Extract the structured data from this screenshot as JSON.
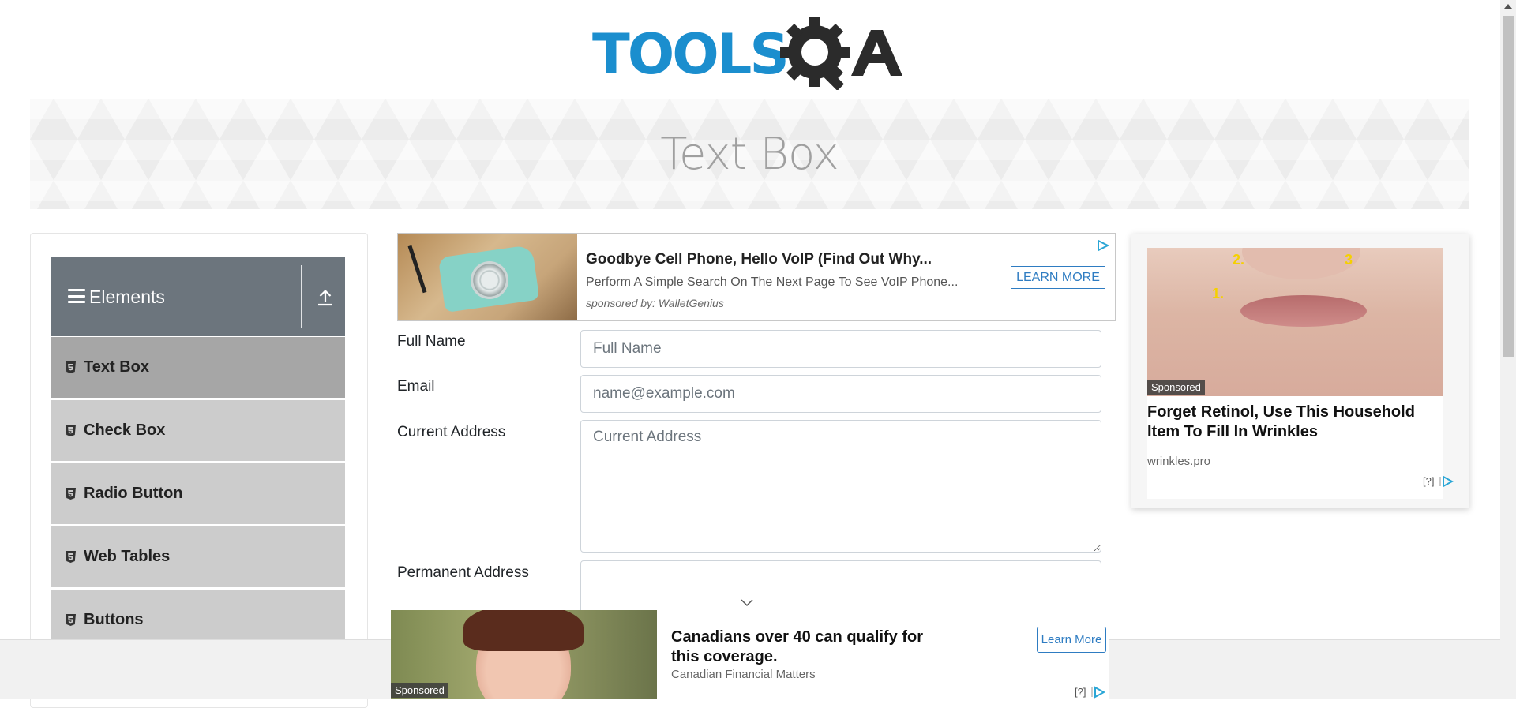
{
  "header": {
    "logo_text": "TOOLSQA",
    "page_title": "Text Box"
  },
  "sidebar": {
    "group_title": "Elements",
    "items": [
      {
        "label": "Text Box",
        "active": true
      },
      {
        "label": "Check Box",
        "active": false
      },
      {
        "label": "Radio Button",
        "active": false
      },
      {
        "label": "Web Tables",
        "active": false
      },
      {
        "label": "Buttons",
        "active": false
      }
    ]
  },
  "top_ad": {
    "headline": "Goodbye Cell Phone, Hello VoIP (Find Out Why...",
    "description": "Perform A Simple Search On The Next Page To See VoIP Phone...",
    "sponsor": "sponsored by: WalletGenius",
    "cta": "LEARN MORE"
  },
  "form": {
    "full_name": {
      "label": "Full Name",
      "placeholder": "Full Name",
      "value": ""
    },
    "email": {
      "label": "Email",
      "placeholder": "name@example.com",
      "value": ""
    },
    "current_address": {
      "label": "Current Address",
      "placeholder": "Current Address",
      "value": ""
    },
    "permanent_address": {
      "label": "Permanent Address",
      "placeholder": "",
      "value": ""
    }
  },
  "right_ad": {
    "badge": "Sponsored",
    "markers": [
      "1.",
      "2.",
      "3"
    ],
    "headline": "Forget Retinol, Use This Household Item To Fill In Wrinkles",
    "domain": "wrinkles.pro",
    "help": "[?]"
  },
  "bottom_ad": {
    "badge": "Sponsored",
    "headline": "Canadians over 40 can qualify for this coverage.",
    "domain": "Canadian Financial Matters",
    "cta": "Learn More",
    "help": "[?]"
  },
  "colors": {
    "logo_blue": "#1b8ece",
    "logo_dark": "#2b2b2b",
    "sidebar_header": "#6c757d",
    "menu_item": "#cccccc",
    "menu_item_active": "#a6a6a6",
    "ad_link": "#2e7cc2"
  },
  "icons": [
    "hamburger-icon",
    "collapse-arrow-icon",
    "html5-icon",
    "adchoices-icon",
    "chevron-down-icon"
  ]
}
